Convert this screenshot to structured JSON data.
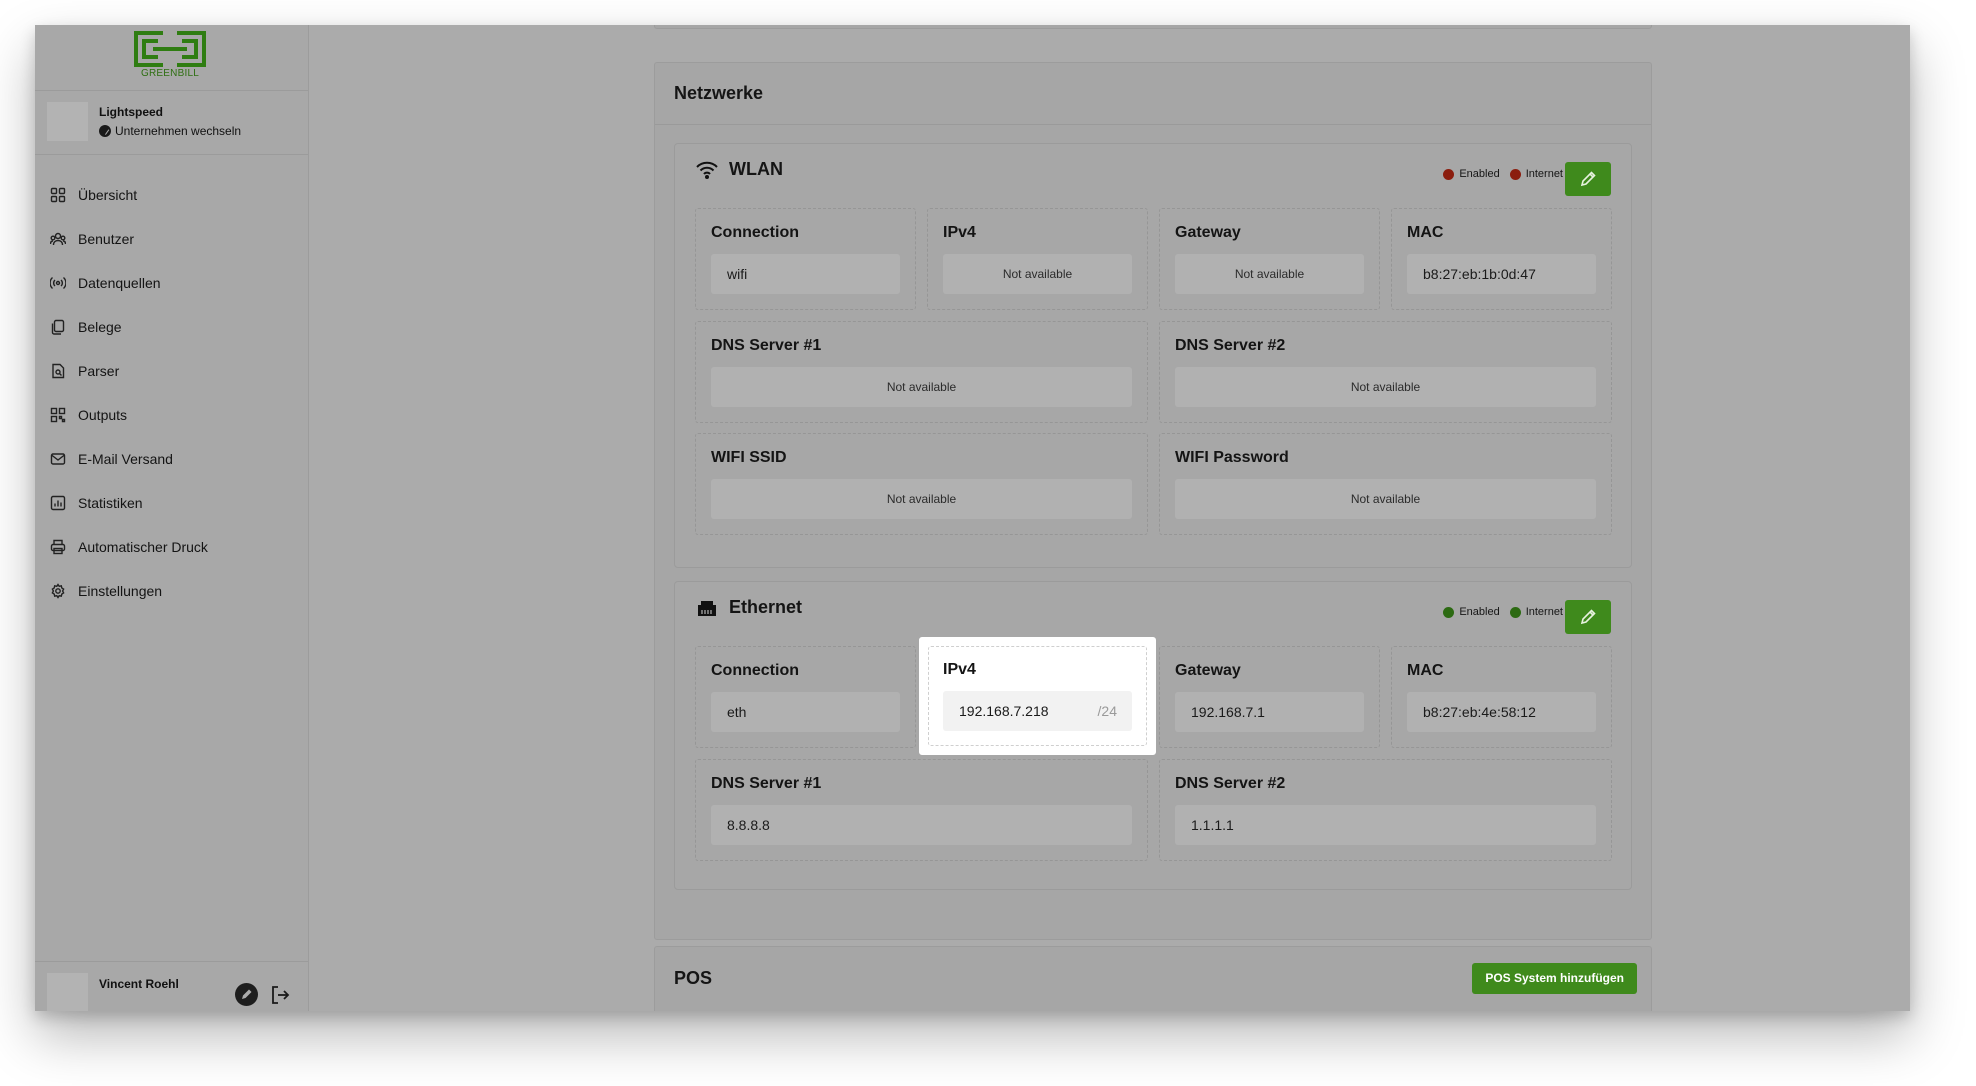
{
  "brand": {
    "logo_text": "GREENBILL"
  },
  "company": {
    "name": "Lightspeed",
    "switch_label": "Unternehmen wechseln"
  },
  "nav": [
    {
      "label": "Übersicht",
      "icon": "grid-icon"
    },
    {
      "label": "Benutzer",
      "icon": "users-icon"
    },
    {
      "label": "Datenquellen",
      "icon": "broadcast-icon"
    },
    {
      "label": "Belege",
      "icon": "documents-icon"
    },
    {
      "label": "Parser",
      "icon": "parser-icon"
    },
    {
      "label": "Outputs",
      "icon": "qr-icon"
    },
    {
      "label": "E-Mail Versand",
      "icon": "mail-icon"
    },
    {
      "label": "Statistiken",
      "icon": "chart-icon"
    },
    {
      "label": "Automatischer Druck",
      "icon": "printer-icon"
    },
    {
      "label": "Einstellungen",
      "icon": "gear-icon"
    }
  ],
  "user": {
    "name": "Vincent Roehl"
  },
  "networks": {
    "title": "Netzwerke",
    "wlan": {
      "title": "WLAN",
      "enabled_label": "Enabled",
      "internet_label": "Internet",
      "enabled_color": "#8b1d0e",
      "internet_color": "#8b1d0e",
      "connection": {
        "label": "Connection",
        "value": "wifi"
      },
      "ipv4": {
        "label": "IPv4",
        "value": "Not available"
      },
      "gateway": {
        "label": "Gateway",
        "value": "Not available"
      },
      "mac": {
        "label": "MAC",
        "value": "b8:27:eb:1b:0d:47"
      },
      "dns1": {
        "label": "DNS Server #1",
        "value": "Not available"
      },
      "dns2": {
        "label": "DNS Server #2",
        "value": "Not available"
      },
      "ssid": {
        "label": "WIFI SSID",
        "value": "Not available"
      },
      "password": {
        "label": "WIFI Password",
        "value": "Not available"
      }
    },
    "ethernet": {
      "title": "Ethernet",
      "enabled_label": "Enabled",
      "internet_label": "Internet",
      "enabled_color": "#2c6a12",
      "internet_color": "#2c6a12",
      "connection": {
        "label": "Connection",
        "value": "eth"
      },
      "ipv4": {
        "label": "IPv4",
        "value": "192.168.7.218",
        "suffix": "/24"
      },
      "gateway": {
        "label": "Gateway",
        "value": "192.168.7.1"
      },
      "mac": {
        "label": "MAC",
        "value": "b8:27:eb:4e:58:12"
      },
      "dns1": {
        "label": "DNS Server #1",
        "value": "8.8.8.8"
      },
      "dns2": {
        "label": "DNS Server #2",
        "value": "1.1.1.1"
      }
    }
  },
  "pos": {
    "title": "POS",
    "add_button": "POS System hinzufügen"
  },
  "colors": {
    "accent": "#3f8a1c",
    "overlay": "#ababab"
  }
}
